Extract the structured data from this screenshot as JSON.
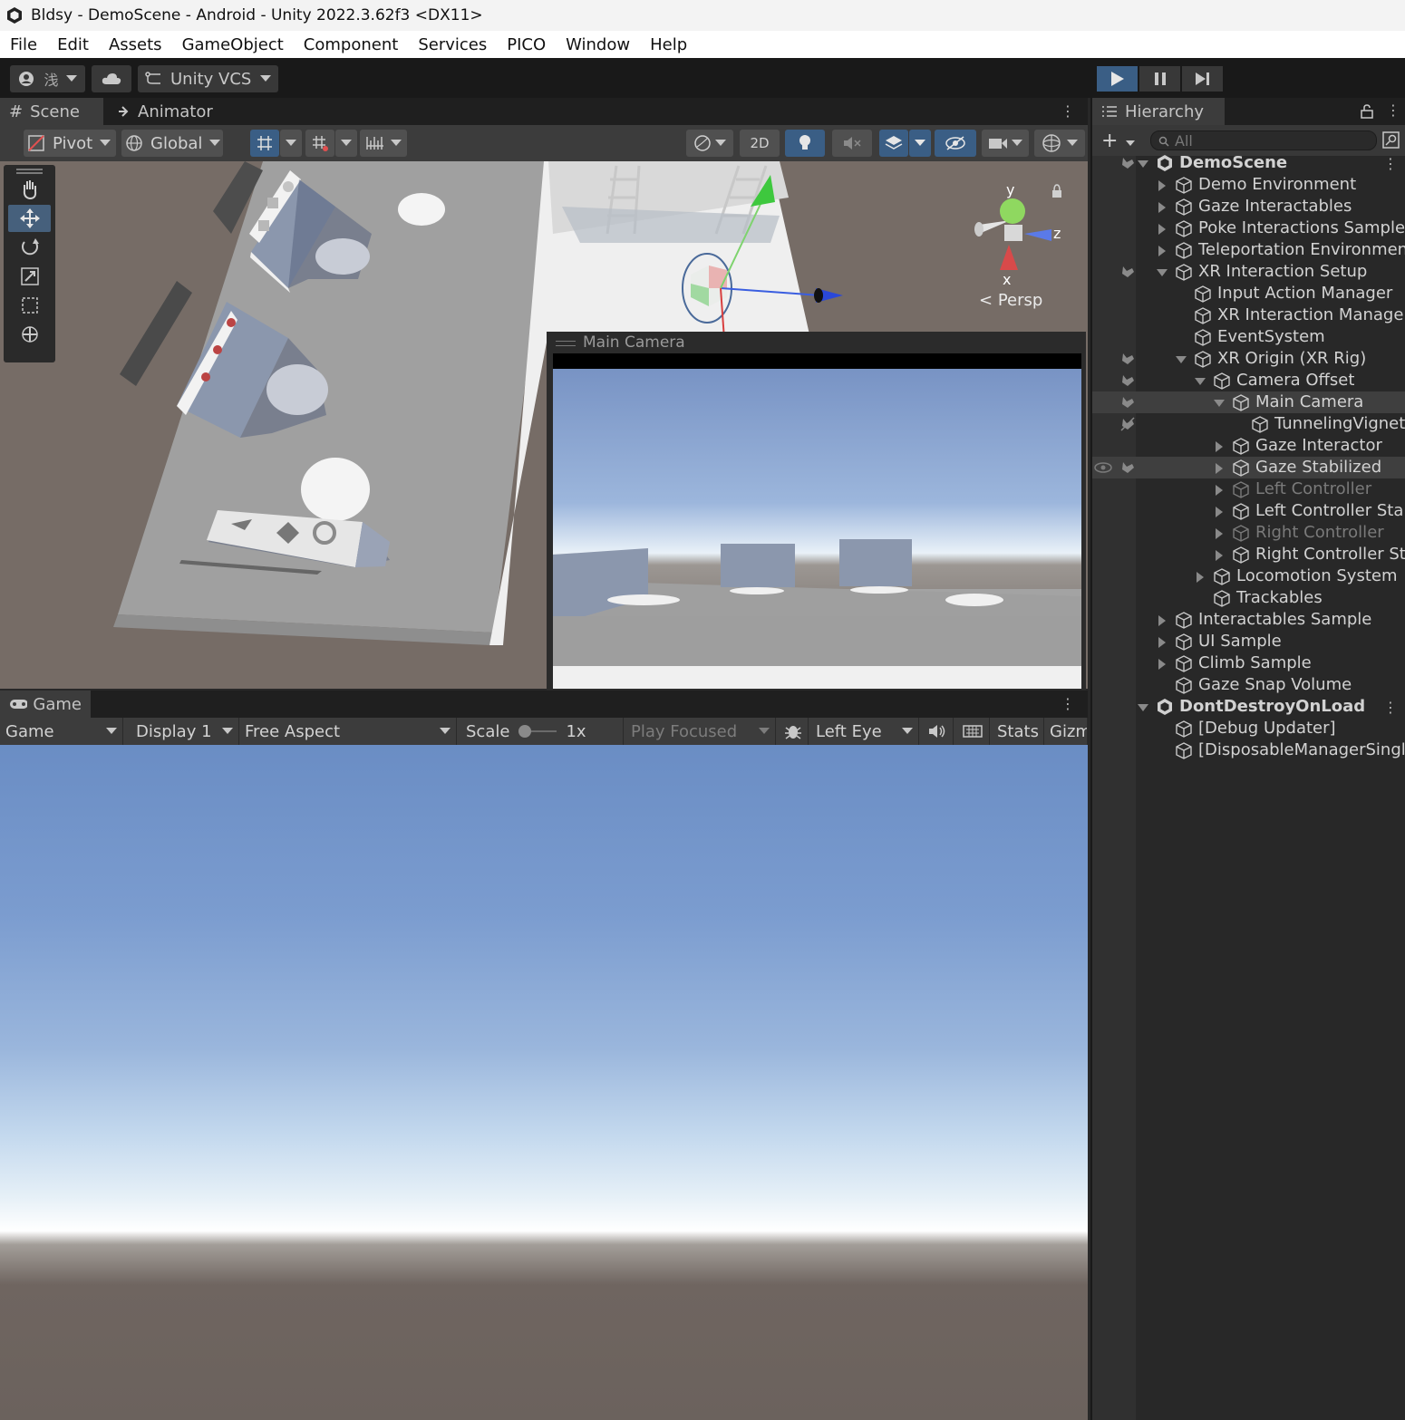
{
  "window": {
    "title": "Bldsy - DemoScene - Android - Unity 2022.3.62f3 <DX11>"
  },
  "menu": [
    "File",
    "Edit",
    "Assets",
    "GameObject",
    "Component",
    "Services",
    "PICO",
    "Window",
    "Help"
  ],
  "toolbar": {
    "account_label": "浅",
    "vcs_label": "Unity VCS",
    "play_icon": "play-icon",
    "pause_icon": "pause-icon",
    "step_icon": "step-icon",
    "play_active_color": "#3a5e85"
  },
  "scene_panel": {
    "tabs": [
      {
        "label": "Scene",
        "icon": "grid-icon",
        "active": true
      },
      {
        "label": "Animator",
        "icon": "animator-icon",
        "active": false
      }
    ],
    "pivot_label": "Pivot",
    "global_label": "Global",
    "mode_2d_label": "2D",
    "gizmo": {
      "y_label": "y",
      "z_label": "z",
      "x_label": "x",
      "projection_label": "Persp"
    },
    "camera_preview_title": "Main Camera"
  },
  "game_panel": {
    "tab_label": "Game",
    "view_dropdown": "Game",
    "display_dropdown": "Display 1",
    "aspect_dropdown": "Free Aspect",
    "scale_label": "Scale",
    "scale_value": "1x",
    "play_mode_dropdown": "Play Focused",
    "eye_dropdown": "Left Eye",
    "stats_label": "Stats",
    "gizmos_label": "Gizm"
  },
  "hierarchy": {
    "tab_label": "Hierarchy",
    "search_placeholder": "All",
    "rows": [
      {
        "label": "DemoScene",
        "depth": 0,
        "expand": "down",
        "kind": "scene",
        "gutter": "hand"
      },
      {
        "label": "Demo Environment",
        "depth": 1,
        "expand": "right"
      },
      {
        "label": "Gaze Interactables",
        "depth": 1,
        "expand": "right"
      },
      {
        "label": "Poke Interactions Sample",
        "depth": 1,
        "expand": "right"
      },
      {
        "label": "Teleportation Environment",
        "depth": 1,
        "expand": "right"
      },
      {
        "label": "XR Interaction Setup",
        "depth": 1,
        "expand": "down",
        "gutter": "hand"
      },
      {
        "label": "Input Action Manager",
        "depth": 2
      },
      {
        "label": "XR Interaction Manager",
        "depth": 2
      },
      {
        "label": "EventSystem",
        "depth": 2
      },
      {
        "label": "XR Origin (XR Rig)",
        "depth": 2,
        "expand": "down",
        "gutter": "hand"
      },
      {
        "label": "Camera Offset",
        "depth": 3,
        "expand": "down",
        "gutter": "hand"
      },
      {
        "label": "Main Camera",
        "depth": 4,
        "expand": "down",
        "gutter": "hand",
        "selected": true
      },
      {
        "label": "TunnelingVignette",
        "depth": 5,
        "gutter": "hand-off"
      },
      {
        "label": "Gaze Interactor",
        "depth": 4,
        "expand": "right"
      },
      {
        "label": "Gaze Stabilized",
        "depth": 4,
        "expand": "right",
        "gutter": "eye-hand",
        "selected": true
      },
      {
        "label": "Left Controller",
        "depth": 4,
        "expand": "right",
        "dim": true
      },
      {
        "label": "Left Controller Stabilized",
        "depth": 4,
        "expand": "right"
      },
      {
        "label": "Right Controller",
        "depth": 4,
        "expand": "right",
        "dim": true
      },
      {
        "label": "Right Controller Stabilized",
        "depth": 4,
        "expand": "right"
      },
      {
        "label": "Locomotion System",
        "depth": 3,
        "expand": "right"
      },
      {
        "label": "Trackables",
        "depth": 3
      },
      {
        "label": "Interactables Sample",
        "depth": 1,
        "expand": "right"
      },
      {
        "label": "UI Sample",
        "depth": 1,
        "expand": "right"
      },
      {
        "label": "Climb Sample",
        "depth": 1,
        "expand": "right"
      },
      {
        "label": "Gaze Snap Volume",
        "depth": 1
      },
      {
        "label": "DontDestroyOnLoad",
        "depth": 0,
        "expand": "down",
        "kind": "scene"
      },
      {
        "label": "[Debug Updater]",
        "depth": 1
      },
      {
        "label": "[DisposableManagerSingleton]",
        "depth": 1
      }
    ]
  }
}
